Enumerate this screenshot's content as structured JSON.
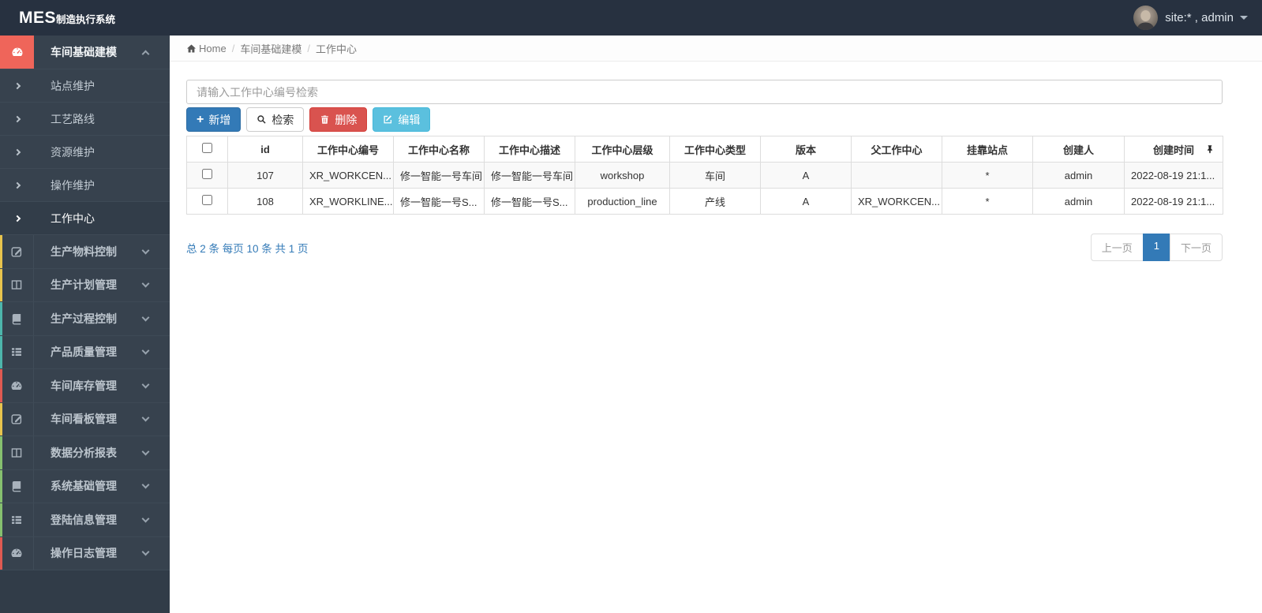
{
  "navbar": {
    "brand_main": "MES",
    "brand_sub": "制造执行系统",
    "user_label": "site:* , admin"
  },
  "breadcrumb": {
    "home": "Home",
    "section": "车间基础建模",
    "page": "工作中心",
    "separator": "/"
  },
  "sidebar": {
    "open_section": {
      "label": "车间基础建模",
      "icon": "gauge-icon",
      "accent": "#ef655a",
      "children": [
        {
          "label": "站点维护"
        },
        {
          "label": "工艺路线"
        },
        {
          "label": "资源维护"
        },
        {
          "label": "操作维护"
        },
        {
          "label": "工作中心"
        }
      ]
    },
    "sections": [
      {
        "label": "生产物料控制",
        "icon": "edit-icon",
        "stripe": "#e8c44d"
      },
      {
        "label": "生产计划管理",
        "icon": "columns-icon",
        "stripe": "#e8c44d"
      },
      {
        "label": "生产过程控制",
        "icon": "book-icon",
        "stripe": "#4db6ac"
      },
      {
        "label": "产品质量管理",
        "icon": "list-icon",
        "stripe": "#4db6ac"
      },
      {
        "label": "车间库存管理",
        "icon": "gauge-icon",
        "stripe": "#e05a52"
      },
      {
        "label": "车间看板管理",
        "icon": "edit-icon",
        "stripe": "#e8c44d"
      },
      {
        "label": "数据分析报表",
        "icon": "columns-icon",
        "stripe": "#86c06f"
      },
      {
        "label": "系统基础管理",
        "icon": "book-icon",
        "stripe": "#86c06f"
      },
      {
        "label": "登陆信息管理",
        "icon": "list-icon",
        "stripe": "#86c06f"
      },
      {
        "label": "操作日志管理",
        "icon": "gauge-icon",
        "stripe": "#e05a52"
      }
    ]
  },
  "search": {
    "placeholder": "请输入工作中心编号检索"
  },
  "toolbar": {
    "add": "新增",
    "search": "检索",
    "delete": "删除",
    "edit": "编辑"
  },
  "table": {
    "headers": [
      "id",
      "工作中心编号",
      "工作中心名称",
      "工作中心描述",
      "工作中心层级",
      "工作中心类型",
      "版本",
      "父工作中心",
      "挂靠站点",
      "创建人",
      "创建时间"
    ],
    "rows": [
      {
        "id": "107",
        "code": "XR_WORKCEN...",
        "name": "修一智能一号车间",
        "desc": "修一智能一号车间",
        "level": "workshop",
        "type": "车间",
        "version": "A",
        "parent": "",
        "station": "*",
        "creator": "admin",
        "created": "2022-08-19 21:1..."
      },
      {
        "id": "108",
        "code": "XR_WORKLINE...",
        "name": "修一智能一号S...",
        "desc": "修一智能一号S...",
        "level": "production_line",
        "type": "产线",
        "version": "A",
        "parent": "XR_WORKCEN...",
        "station": "*",
        "creator": "admin",
        "created": "2022-08-19 21:1..."
      }
    ]
  },
  "pagination": {
    "summary": "总 2 条 每页 10 条 共 1 页",
    "prev": "上一页",
    "current": "1",
    "next": "下一页"
  },
  "colors": {
    "primary": "#337ab7",
    "danger": "#d9534f",
    "info": "#5bc0de",
    "accent_red": "#ef655a",
    "navbar_bg": "#273140",
    "sidebar_bg": "#37424e"
  }
}
